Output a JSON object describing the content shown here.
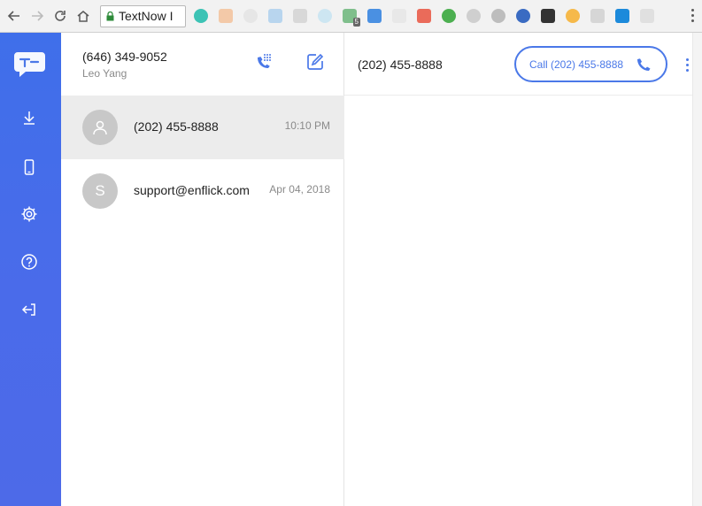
{
  "browser": {
    "tab_title": "TextNow I",
    "icons": [
      "back-icon",
      "forward-icon",
      "reload-icon",
      "home-icon",
      "lock-icon",
      "menu-dots-icon"
    ],
    "extension_badge": "5"
  },
  "rail": {
    "logo_text": "TextNow",
    "items": [
      {
        "icon": "download-icon"
      },
      {
        "icon": "phone-device-icon"
      },
      {
        "icon": "settings-icon"
      },
      {
        "icon": "help-icon"
      },
      {
        "icon": "logout-icon"
      }
    ]
  },
  "account": {
    "number": "(646) 349-9052",
    "name": "Leo Yang"
  },
  "conversations": [
    {
      "title": "(202) 455-8888",
      "time": "10:10 PM",
      "avatar": "",
      "active": true
    },
    {
      "title": "support@enflick.com",
      "time": "Apr 04, 2018",
      "avatar": "S",
      "active": false
    }
  ],
  "thread": {
    "title": "(202) 455-8888",
    "call_label": "Call (202) 455-8888"
  },
  "colors": {
    "accent": "#4a78e8",
    "rail_top": "#3f6fea",
    "active_row": "#ececec"
  }
}
